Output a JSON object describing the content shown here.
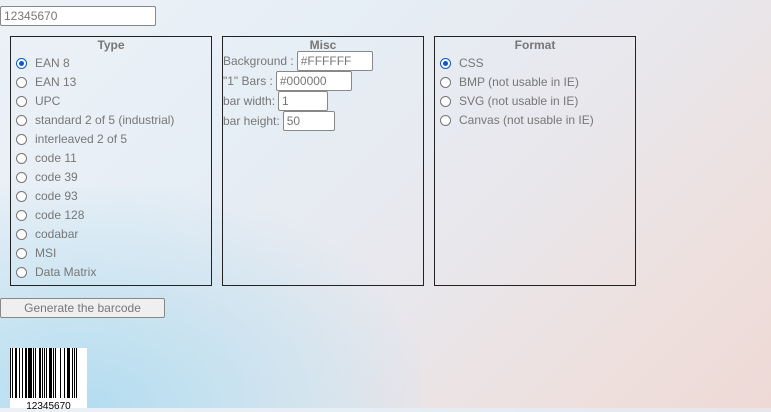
{
  "top_input": {
    "value": "12345670"
  },
  "type_panel": {
    "title": "Type",
    "options": [
      {
        "label": "EAN 8",
        "checked": true
      },
      {
        "label": "EAN 13",
        "checked": false
      },
      {
        "label": "UPC",
        "checked": false
      },
      {
        "label": "standard 2 of 5 (industrial)",
        "checked": false
      },
      {
        "label": "interleaved 2 of 5",
        "checked": false
      },
      {
        "label": "code 11",
        "checked": false
      },
      {
        "label": "code 39",
        "checked": false
      },
      {
        "label": "code 93",
        "checked": false
      },
      {
        "label": "code 128",
        "checked": false
      },
      {
        "label": "codabar",
        "checked": false
      },
      {
        "label": "MSI",
        "checked": false
      },
      {
        "label": "Data Matrix",
        "checked": false
      }
    ]
  },
  "misc_panel": {
    "title": "Misc",
    "background_label": "Background :",
    "background_value": "#FFFFFF",
    "bars_label": "\"1\" Bars :",
    "bars_value": "#000000",
    "bar_width_label": "bar width:",
    "bar_width_value": "1",
    "bar_height_label": "bar height:",
    "bar_height_value": "50"
  },
  "format_panel": {
    "title": "Format",
    "options": [
      {
        "label": "CSS",
        "checked": true
      },
      {
        "label": "BMP (not usable in IE)",
        "checked": false
      },
      {
        "label": "SVG (not usable in IE)",
        "checked": false
      },
      {
        "label": "Canvas (not usable in IE)",
        "checked": false
      }
    ]
  },
  "generate_button": {
    "label": "Generate the barcode"
  },
  "barcode": {
    "text": "12345670",
    "bar_color": "#000000",
    "background": "#FFFFFF"
  }
}
